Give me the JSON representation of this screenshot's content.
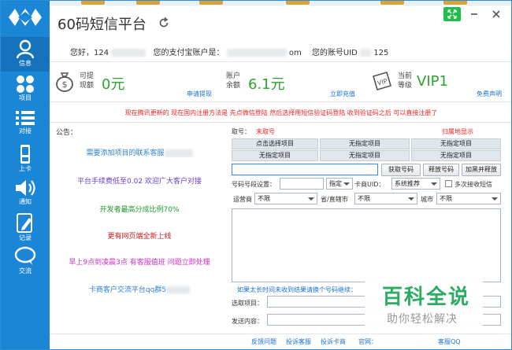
{
  "app": {
    "title": "60码短信平台"
  },
  "window": {
    "max_icon": "maximize-icon",
    "min_icon": "minimize-icon",
    "close_icon": "close-icon"
  },
  "sidebar": {
    "items": [
      {
        "label": "信息",
        "icon": "user-icon"
      },
      {
        "label": "项目",
        "icon": "grid-icon"
      },
      {
        "label": "对接",
        "icon": "list-icon"
      },
      {
        "label": "上卡",
        "icon": "phone-icon"
      },
      {
        "label": "通知",
        "icon": "speaker-icon"
      },
      {
        "label": "记录",
        "icon": "pen-icon"
      },
      {
        "label": "交流",
        "icon": "chat-icon"
      }
    ]
  },
  "user": {
    "hello": "您好，124",
    "alipay_label": "您的支付宝账户是：",
    "alipay_suffix": "om",
    "uid_label": "您的账号UID",
    "uid_suffix": "125"
  },
  "stats": {
    "withdrawable_label1": "可提",
    "withdrawable_label2": "现额",
    "withdrawable_value": "0元",
    "withdraw_link": "申请提现",
    "balance_label1": "账户",
    "balance_label2": "余额",
    "balance_value": "6.1元",
    "recharge_link": "立即充值",
    "level_label1": "当前",
    "level_label2": "等级",
    "level_value": "VIP1",
    "vip_badge": "VIP",
    "free_link": "免费声明"
  },
  "notice": "现在腾讯更新的 现在国内注册方法是 先点微信登陆 然后选择用短信验证码登陆 收到验证码之后 可以直接注册了",
  "announcement": {
    "title": "公告：",
    "lines": [
      {
        "text": "需要添加项目的联系客服",
        "color": "#2b7fd4"
      },
      {
        "text": "平台手续费低至0.02 欢迎广大客户对接",
        "color": "#6b3fc8"
      },
      {
        "text": "开发者最高分成比例70%",
        "color": "#1a9a2a"
      },
      {
        "text": "更有网页端全新上线",
        "color": "#d01b1b"
      },
      {
        "text": "早上9点到凌晨3点 有客服值班 问题立即处理",
        "color": "#d52fc8"
      },
      {
        "text": "卡商客户交流平台qq群5",
        "color": "#2b7fd4"
      }
    ]
  },
  "panel": {
    "number_label": "取号：",
    "number_status": "未取号",
    "region_status": "归属地显示",
    "project_cells": [
      "点击选择项目",
      "无指定项目",
      "无指定项目",
      "无指定项目",
      "无指定项目",
      "无指定项目"
    ],
    "btn_get": "获取号码",
    "btn_release": "释放号码",
    "btn_blacklist": "加黑并释放",
    "segment_label": "号码号段设置：",
    "specify_label": "指定",
    "card_uid_label": "卡商UID：",
    "recommend_value": "系统推荐",
    "multi_label": "多次接收短信",
    "operator_label": "运营商",
    "operator_value": "不限",
    "province_label": "省/直辖市",
    "province_value": "不限",
    "city_label": "城市",
    "city_value": "不限",
    "hint": "如果太长时间未收到结果请换个号码继续：",
    "select_project_label": "选取项目：",
    "send_content_label": "发送内容："
  },
  "footer": {
    "feedback": "反馈问题",
    "complain_service": "投诉客服",
    "complain_card": "投诉卡商",
    "website": "官网：",
    "service_qq": "客服QQ"
  },
  "watermark": {
    "line1": "百科全说",
    "line2": "助你轻松解决"
  },
  "colors": {
    "sidebar": "#1c86d6",
    "accent_green": "#2aa52a",
    "link": "#1a6fd0",
    "notice_red": "#e22222"
  }
}
